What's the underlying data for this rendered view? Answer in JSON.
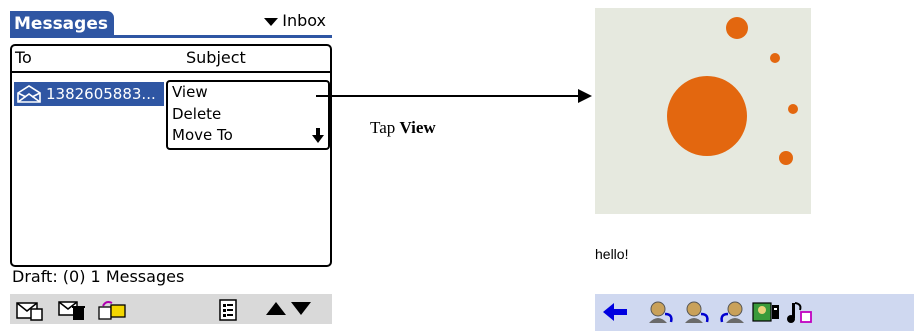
{
  "left_screen": {
    "app_title": "Messages",
    "category": "Inbox",
    "columns": {
      "to": "To",
      "subject": "Subject"
    },
    "selected_message": {
      "to": "1382605883..."
    },
    "popup_menu": [
      "View",
      "Delete",
      "Move To"
    ],
    "status": "Draft: (0) 1 Messages",
    "toolbar_icons": [
      "new-message-icon",
      "delete-message-icon",
      "move-to-folder-icon",
      "details-icon",
      "scroll-up-icon",
      "scroll-down-icon"
    ]
  },
  "annotation": {
    "prefix": "Tap ",
    "action": "View"
  },
  "right_screen": {
    "message_text": "hello!",
    "toolbar_icons": [
      "back-arrow-icon",
      "contact-icon-1",
      "contact-icon-2",
      "contact-icon-3",
      "picture-icon",
      "music-icon"
    ]
  },
  "colors": {
    "palm_blue": "#2f56a3",
    "circle_orange": "#e3670f",
    "image_background": "#e6e9df",
    "viewer_toolbar": "#cfd8f0"
  }
}
